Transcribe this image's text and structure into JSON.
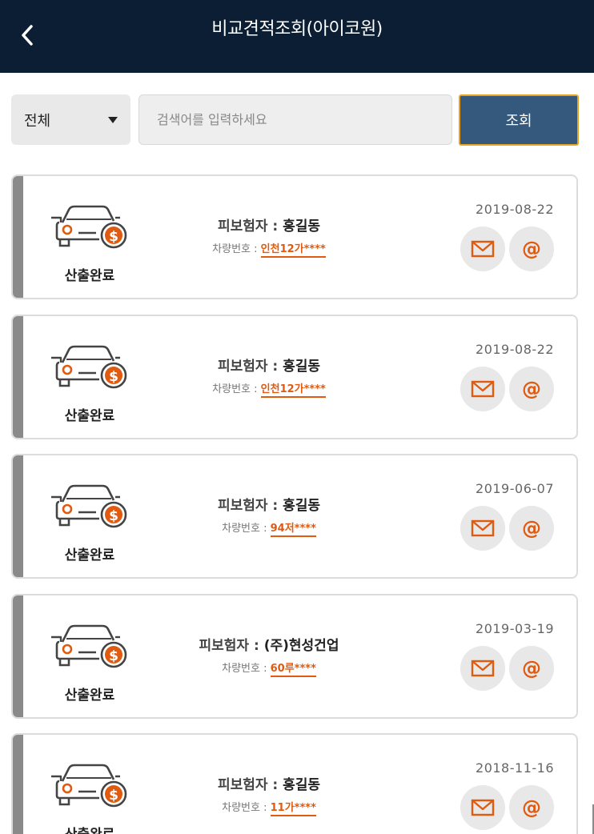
{
  "header": {
    "title": "비교견적조회(아이코원)",
    "back_icon": "chevron-left-icon"
  },
  "search": {
    "filter_value": "전체",
    "placeholder": "검색어를 입력하세요",
    "button_label": "조회"
  },
  "colors": {
    "header_bg": "#0b1e33",
    "accent_orange": "#e05a10",
    "search_button_bg": "#34597c",
    "search_button_border": "#e9a11f"
  },
  "labels": {
    "insured": "피보험자 : ",
    "plate": "차량번호 : "
  },
  "quotes": [
    {
      "status": "산출완료",
      "insured_name": "홍길동",
      "plate": "인천12가****",
      "date": "2019-08-22"
    },
    {
      "status": "산출완료",
      "insured_name": "홍길동",
      "plate": "인천12가****",
      "date": "2019-08-22"
    },
    {
      "status": "산출완료",
      "insured_name": "홍길동",
      "plate": "94저****",
      "date": "2019-06-07"
    },
    {
      "status": "산출완료",
      "insured_name": "(주)현성건업",
      "plate": "60루****",
      "date": "2019-03-19"
    },
    {
      "status": "산출완료",
      "insured_name": "홍길동",
      "plate": "11가****",
      "date": "2018-11-16"
    }
  ],
  "actions": {
    "mail_icon": "mail-icon",
    "at_icon": "at-sign-icon",
    "at_glyph": "@"
  }
}
